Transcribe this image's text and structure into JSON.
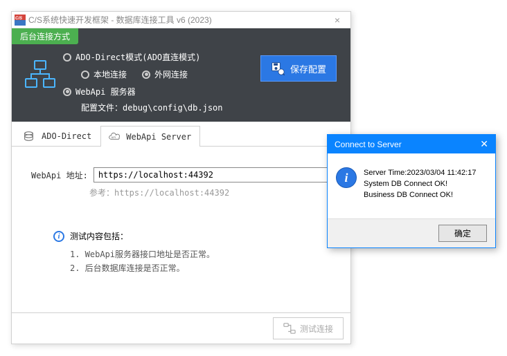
{
  "window": {
    "title": "C/S系统快速开发框架 - 数据库连接工具 v6 (2023)"
  },
  "header": {
    "tag": "后台连接方式",
    "mode1_label": "ADO-Direct模式(ADO直连模式)",
    "sub_local": "本地连接",
    "sub_remote": "外网连接",
    "mode2_label": "WebApi 服务器",
    "config_file_label": "配置文件：",
    "config_file_value": "debug\\config\\db.json",
    "save_button": "保存配置"
  },
  "tabs": {
    "t0": "ADO-Direct",
    "t1": "WebApi Server"
  },
  "content": {
    "url_label": "WebApi 地址:",
    "url_value": "https://localhost:44392",
    "url_hint": "参考：https://localhost:44392",
    "test_title": "测试内容包括：",
    "test_item1": "1. WebApi服务器接口地址是否正常。",
    "test_item2": "2. 后台数据库连接是否正常。"
  },
  "footer": {
    "test_button": "测试连接"
  },
  "dialog": {
    "title": "Connect to Server",
    "line1": "Server Time:2023/03/04 11:42:17",
    "line2": "System DB Connect OK!",
    "line3": "Business DB Connect OK!",
    "ok": "确定"
  }
}
